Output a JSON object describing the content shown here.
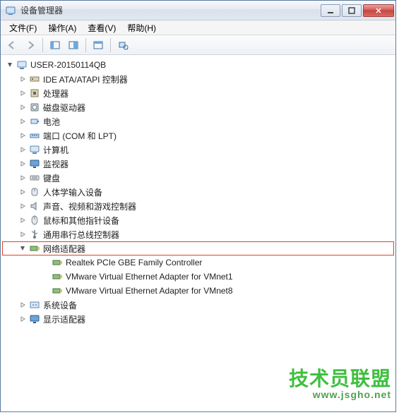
{
  "window": {
    "title": "设备管理器"
  },
  "menu": {
    "file": "文件(F)",
    "action": "操作(A)",
    "view": "查看(V)",
    "help": "帮助(H)"
  },
  "tree": {
    "root": "USER-20150114QB",
    "nodes": [
      {
        "label": "IDE ATA/ATAPI 控制器",
        "icon": "ide"
      },
      {
        "label": "处理器",
        "icon": "cpu"
      },
      {
        "label": "磁盘驱动器",
        "icon": "disk"
      },
      {
        "label": "电池",
        "icon": "battery"
      },
      {
        "label": "端口 (COM 和 LPT)",
        "icon": "port"
      },
      {
        "label": "计算机",
        "icon": "computer"
      },
      {
        "label": "监视器",
        "icon": "monitor"
      },
      {
        "label": "键盘",
        "icon": "keyboard"
      },
      {
        "label": "人体学输入设备",
        "icon": "hid"
      },
      {
        "label": "声音、视频和游戏控制器",
        "icon": "sound"
      },
      {
        "label": "鼠标和其他指针设备",
        "icon": "mouse"
      },
      {
        "label": "通用串行总线控制器",
        "icon": "usb"
      }
    ],
    "network": {
      "label": "网络适配器",
      "children": [
        "Realtek PCIe GBE Family Controller",
        "VMware Virtual Ethernet Adapter for VMnet1",
        "VMware Virtual Ethernet Adapter for VMnet8"
      ]
    },
    "after": [
      {
        "label": "系统设备",
        "icon": "system"
      },
      {
        "label": "显示适配器",
        "icon": "display"
      }
    ]
  },
  "watermark": {
    "text": "技术员联盟",
    "url": "www.jsgho.net"
  }
}
